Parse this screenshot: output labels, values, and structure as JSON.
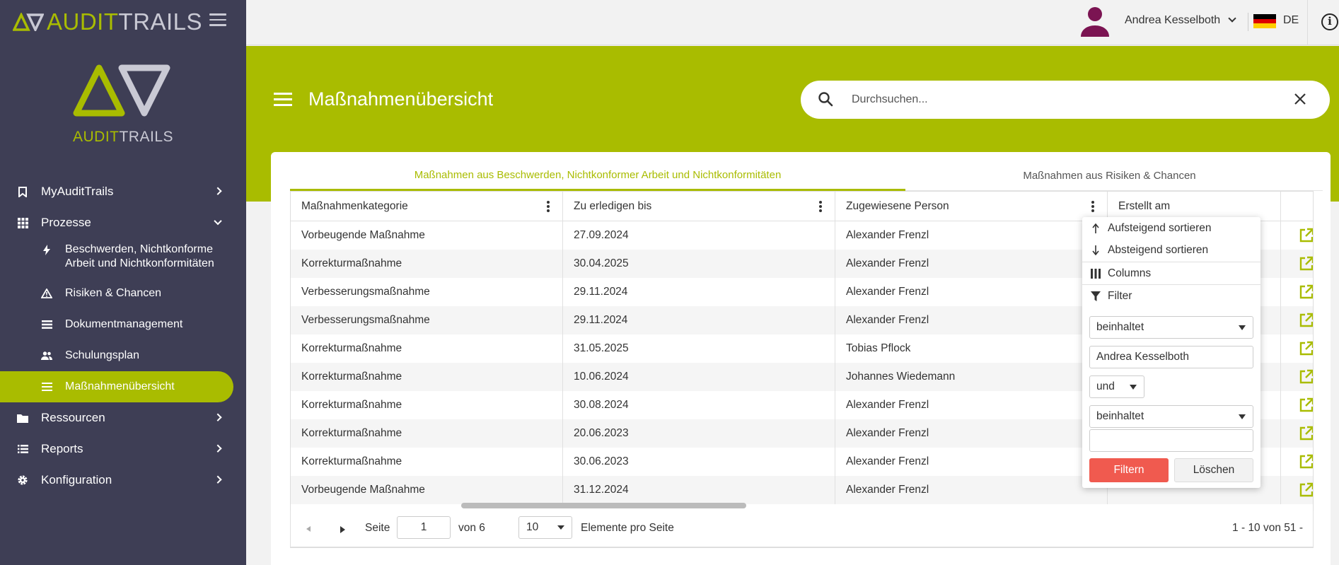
{
  "brand": {
    "logo_part1": "AUDIT",
    "logo_part2": "TRAILS"
  },
  "sidebar": {
    "items": [
      {
        "label": "MyAuditTrails"
      },
      {
        "label": "Prozesse"
      },
      {
        "label": "Ressourcen"
      },
      {
        "label": "Reports"
      },
      {
        "label": "Konfiguration"
      }
    ],
    "sub_items": [
      {
        "label_line1": "Beschwerden, Nichtkonforme",
        "label_line2": "Arbeit und Nichtkonformitäten"
      },
      {
        "label": "Risiken & Chancen"
      },
      {
        "label": "Dokumentmanagement"
      },
      {
        "label": "Schulungsplan"
      },
      {
        "label": "Maßnahmenübersicht"
      }
    ]
  },
  "topbar": {
    "user_name": "Andrea Kesselboth",
    "language": "DE"
  },
  "header": {
    "title": "Maßnahmenübersicht",
    "search_placeholder": "Durchsuchen..."
  },
  "tabs": [
    {
      "label": "Maßnahmen aus Beschwerden, Nichtkonformer Arbeit und Nichtkonformitäten"
    },
    {
      "label": "Maßnahmen aus Risiken & Chancen"
    }
  ],
  "table": {
    "columns": [
      "Maßnahmenkategorie",
      "Zu erledigen bis",
      "Zugewiesene Person",
      "Erstellt am"
    ],
    "rows": [
      [
        "Vorbeugende Maßnahme",
        "27.09.2024",
        "Alexander Frenzl"
      ],
      [
        "Korrekturmaßnahme",
        "30.04.2025",
        "Alexander Frenzl"
      ],
      [
        "Verbesserungsmaßnahme",
        "29.11.2024",
        "Alexander Frenzl"
      ],
      [
        "Verbesserungsmaßnahme",
        "29.11.2024",
        "Alexander Frenzl"
      ],
      [
        "Korrekturmaßnahme",
        "31.05.2025",
        "Tobias Pflock"
      ],
      [
        "Korrekturmaßnahme",
        "10.06.2024",
        "Johannes Wiedemann"
      ],
      [
        "Korrekturmaßnahme",
        "30.08.2024",
        "Alexander Frenzl"
      ],
      [
        "Korrekturmaßnahme",
        "20.06.2023",
        "Alexander Frenzl"
      ],
      [
        "Korrekturmaßnahme",
        "30.06.2023",
        "Alexander Frenzl"
      ],
      [
        "Vorbeugende Maßnahme",
        "31.12.2024",
        "Alexander Frenzl"
      ]
    ]
  },
  "pager": {
    "page_label": "Seite",
    "page_value": "1",
    "of_label": "von 6",
    "page_size": "10",
    "per_page_label": "Elemente pro Seite",
    "range": "1 - 10 von 51 -"
  },
  "column_menu": {
    "sort_asc": "Aufsteigend sortieren",
    "sort_desc": "Absteigend sortieren",
    "columns": "Columns",
    "filter": "Filter",
    "operator1": "beinhaltet",
    "value1": "Andrea Kesselboth",
    "logic": "und",
    "operator2": "beinhaltet",
    "value2": "",
    "filter_button": "Filtern",
    "clear_button": "Löschen"
  },
  "colors": {
    "accent": "#a9bc00",
    "sidebar": "#3e3e55",
    "danger": "#f05a4f"
  }
}
